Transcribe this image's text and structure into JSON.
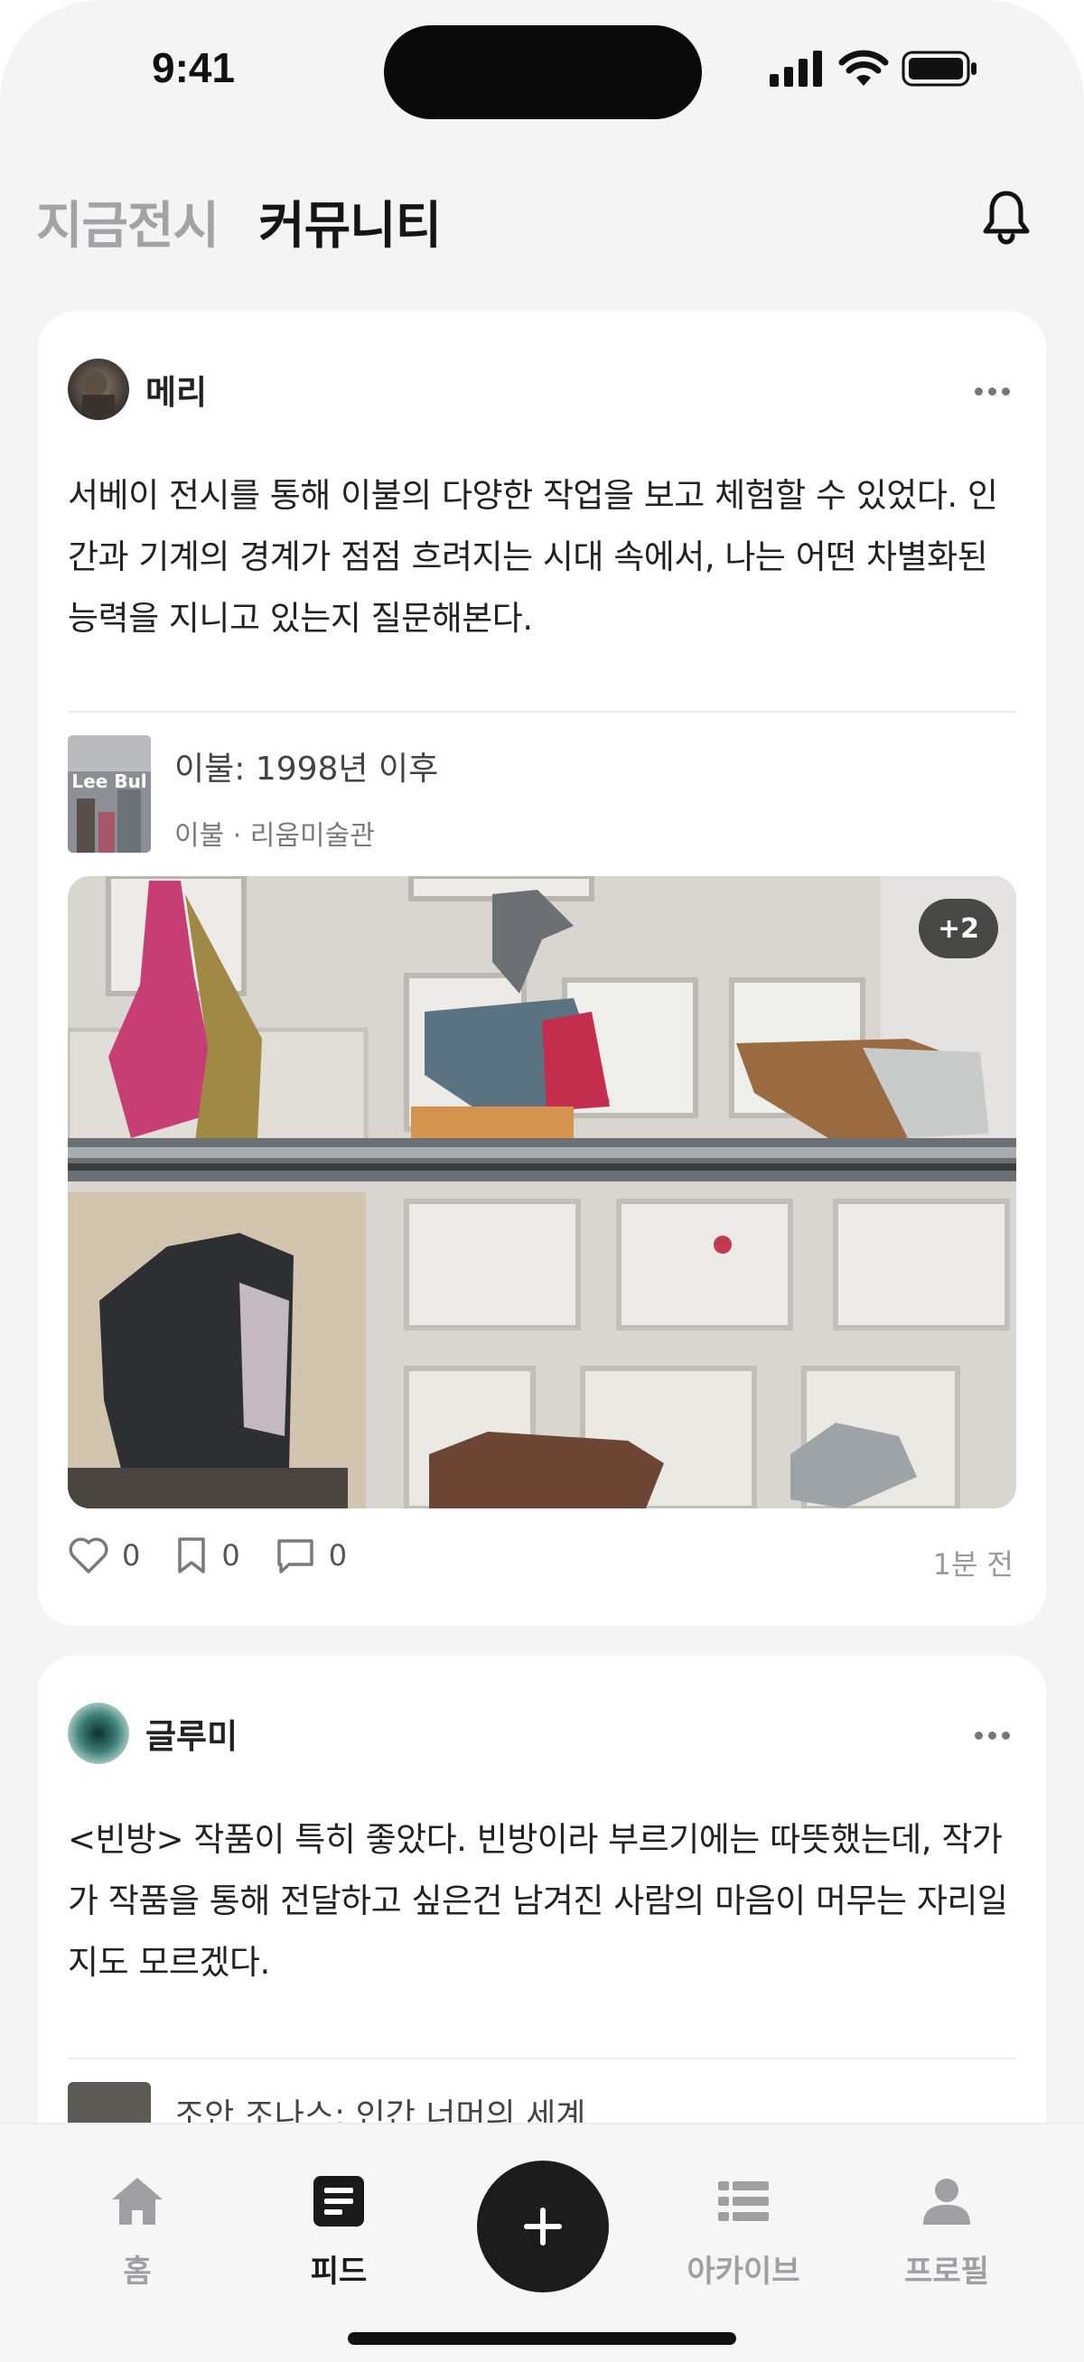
{
  "status_bar": {
    "time": "9:41"
  },
  "header": {
    "tabs": [
      {
        "label": "지금전시",
        "active": false
      },
      {
        "label": "커뮤니티",
        "active": true
      }
    ]
  },
  "posts": [
    {
      "author": "메리",
      "text": "서베이 전시를 통해 이불의 다양한 작업을 보고 체험할 수 있었다. 인간과 기계의 경계가 점점 흐려지는 시대 속에서, 나는 어떤 차별화된 능력을 지니고 있는지 질문해본다.",
      "exhibition": {
        "title": "이불: 1998년 이후",
        "subtitle": "이불 · 리움미술관",
        "poster_text": "Lee Bul"
      },
      "more_images": "+2",
      "likes": "0",
      "bookmarks": "0",
      "comments": "0",
      "time_ago": "1분 전"
    },
    {
      "author": "글루미",
      "text": "<빈방> 작품이 특히 좋았다. 빈방이라 부르기에는 따뜻했는데,  작가가 작품을 통해 전달하고 싶은건 남겨진 사람의 마음이 머무는 자리일지도 모르겠다.",
      "exhibition": {
        "title": "조안 조나스: 인간 너머의 세계"
      }
    }
  ],
  "bottom_nav": {
    "items": [
      {
        "label": "홈",
        "icon": "home-icon",
        "active": false
      },
      {
        "label": "피드",
        "icon": "feed-icon",
        "active": true
      },
      {
        "label": "아카이브",
        "icon": "list-icon",
        "active": false
      },
      {
        "label": "프로필",
        "icon": "person-icon",
        "active": false
      }
    ]
  },
  "colors": {
    "background": "#f4f4f5",
    "card": "#ffffff",
    "text_primary": "#222222",
    "text_muted": "#a3a3a6",
    "fab": "#1c1c1c"
  }
}
